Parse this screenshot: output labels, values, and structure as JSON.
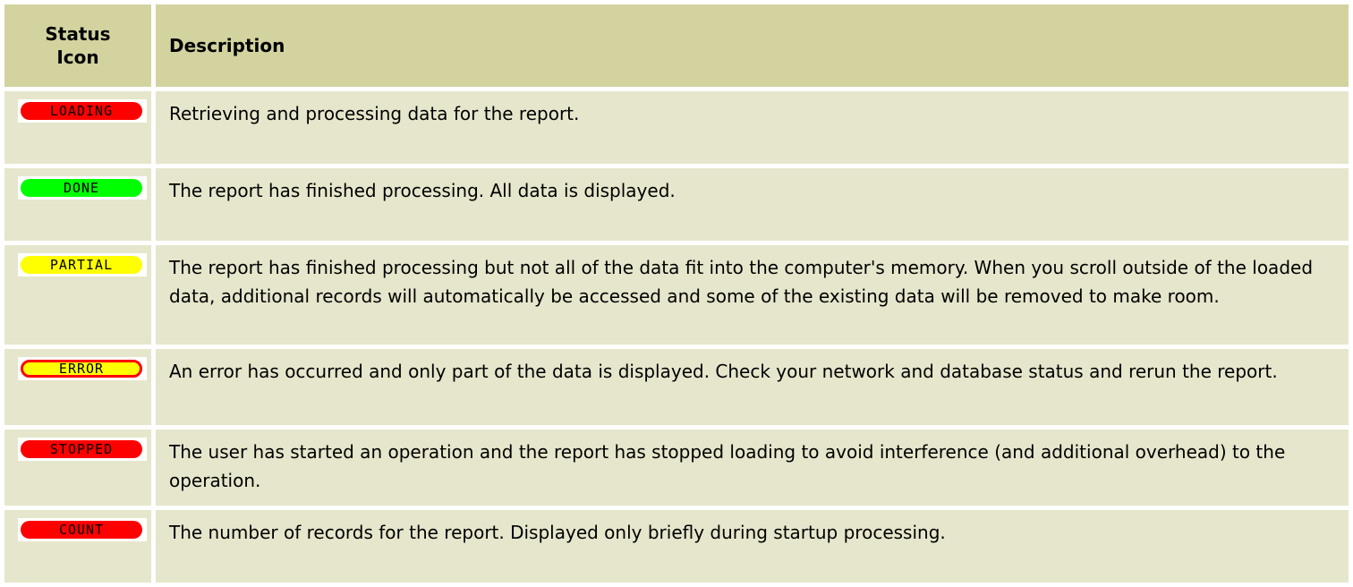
{
  "table": {
    "header": {
      "icon_col_line1": "Status",
      "icon_col_line2": "Icon",
      "desc_col": "Description"
    },
    "rows": [
      {
        "icon_label": "LOADING",
        "icon_name": "status-loading-icon",
        "icon_bg": "#ff0000",
        "icon_text_color": "#000000",
        "description": "Retrieving and processing data for the report."
      },
      {
        "icon_label": "DONE",
        "icon_name": "status-done-icon",
        "icon_bg": "#00ff00",
        "icon_text_color": "#000000",
        "description": "The report has finished processing. All data is displayed."
      },
      {
        "icon_label": "PARTIAL",
        "icon_name": "status-partial-icon",
        "icon_bg": "#ffff00",
        "icon_text_color": "#000000",
        "description": "The report has finished processing but not all of the data fit into the computer's memory. When you scroll outside of the loaded data, additional records will automatically be accessed and some of the existing data will be removed to make room."
      },
      {
        "icon_label": "ERROR",
        "icon_name": "status-error-icon",
        "icon_bg": "#ffff00",
        "icon_border": "#ff0000",
        "icon_text_color": "#000000",
        "description": "An error has occurred and only part of the data is displayed. Check your network and database status and rerun the report."
      },
      {
        "icon_label": "STOPPED",
        "icon_name": "status-stopped-icon",
        "icon_bg": "#ff0000",
        "icon_text_color": "#000000",
        "description": "The user has started an operation and the report has stopped loading to avoid interference (and additional overhead) to the operation."
      },
      {
        "icon_label": "COUNT",
        "icon_name": "status-count-icon",
        "icon_bg": "#ff0000",
        "icon_text_color": "#000000",
        "description": "The number of records for the report. Displayed only briefly during startup processing."
      }
    ]
  },
  "colors": {
    "header_bg": "#d3d3a0",
    "row_bg": "#e6e6cc",
    "border": "#ffffff"
  }
}
